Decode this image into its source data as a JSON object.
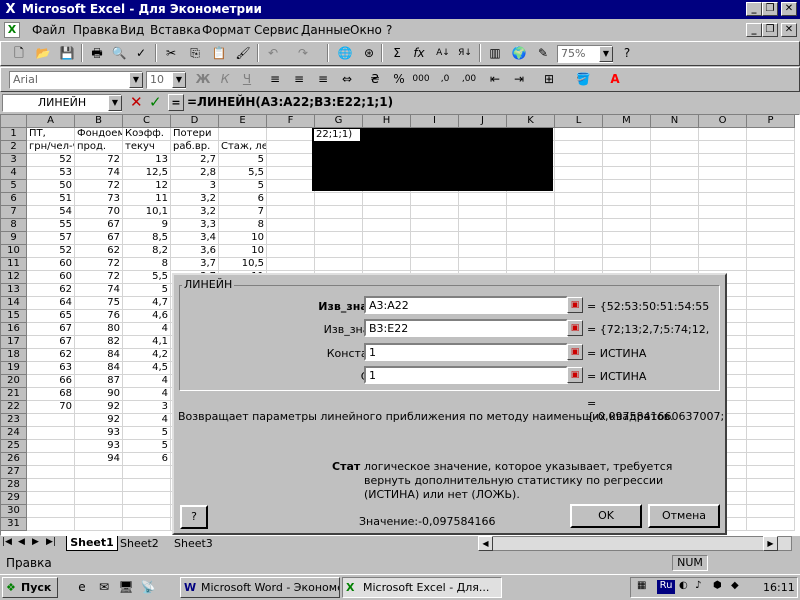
{
  "title": "Microsoft Excel - Для Эконометрии",
  "menu": [
    "Файл",
    "Правка",
    "Вид",
    "Вставка",
    "Формат",
    "Сервис",
    "Данные",
    "Окно",
    "?"
  ],
  "toolbar": {
    "zoom": "75%",
    "font": "Arial",
    "size": "10"
  },
  "namebox": "ЛИНЕЙН",
  "formula": "=ЛИНЕЙН(A3:A22;B3:E22;1;1)",
  "columns": [
    "A",
    "B",
    "C",
    "D",
    "E",
    "F",
    "G",
    "H",
    "I",
    "J",
    "K",
    "L",
    "M",
    "N",
    "O",
    "P"
  ],
  "rows": [
    [
      "ПТ,",
      "Фондоем",
      "Коэфф.",
      "Потери",
      ""
    ],
    [
      "грн/чел-ч",
      "прод.",
      "текуч",
      "раб.вр.",
      "Стаж, лет"
    ],
    [
      "52",
      "72",
      "13",
      "2,7",
      "5"
    ],
    [
      "53",
      "74",
      "12,5",
      "2,8",
      "5,5"
    ],
    [
      "50",
      "72",
      "12",
      "3",
      "5"
    ],
    [
      "51",
      "73",
      "11",
      "3,2",
      "6"
    ],
    [
      "54",
      "70",
      "10,1",
      "3,2",
      "7"
    ],
    [
      "55",
      "67",
      "9",
      "3,3",
      "8"
    ],
    [
      "57",
      "67",
      "8,5",
      "3,4",
      "10"
    ],
    [
      "52",
      "62",
      "8,2",
      "3,6",
      "10"
    ],
    [
      "60",
      "72",
      "8",
      "3,7",
      "10,5"
    ],
    [
      "60",
      "72",
      "5,5",
      "3,7",
      "11"
    ],
    [
      "62",
      "74",
      "5",
      "",
      ""
    ],
    [
      "64",
      "75",
      "4,7",
      "",
      ""
    ],
    [
      "65",
      "76",
      "4,6",
      "",
      ""
    ],
    [
      "67",
      "80",
      "4",
      "",
      ""
    ],
    [
      "67",
      "82",
      "4,1",
      "",
      ""
    ],
    [
      "62",
      "84",
      "4,2",
      "",
      ""
    ],
    [
      "63",
      "84",
      "4,5",
      "",
      ""
    ],
    [
      "66",
      "87",
      "4",
      "",
      ""
    ],
    [
      "68",
      "90",
      "4",
      "",
      ""
    ],
    [
      "70",
      "92",
      "3",
      "",
      ""
    ],
    [
      "",
      "92",
      "4",
      "",
      ""
    ],
    [
      "",
      "93",
      "5",
      "",
      ""
    ],
    [
      "",
      "93",
      "5",
      "",
      ""
    ],
    [
      "",
      "94",
      "6",
      "",
      ""
    ],
    [
      "",
      "",
      "",
      "",
      ""
    ],
    [
      "",
      "",
      "",
      "",
      ""
    ],
    [
      "",
      "",
      "",
      "",
      ""
    ],
    [
      "",
      "",
      "",
      "",
      ""
    ],
    [
      "",
      "",
      "",
      "",
      ""
    ]
  ],
  "g1_text": "22;1;1)",
  "dialog": {
    "group": "ЛИНЕЙН",
    "fields": [
      {
        "label": "Изв_знач_у",
        "value": "A3:A22",
        "result": "= {52:53:50:51:54:55"
      },
      {
        "label": "Изв_знач_х",
        "value": "B3:E22",
        "result": "= {72;13;2,7;5:74;12,"
      },
      {
        "label": "Константа",
        "value": "1",
        "result": "= ИСТИНА"
      },
      {
        "label": "Стат",
        "value": "1",
        "result": "= ИСТИНА"
      }
    ],
    "overall": "= {-0,0975841660637007;",
    "description": "Возвращает параметры линейного приближения по методу наименьших квадратов.",
    "arg_name": "Стат",
    "arg_desc": "логическое значение, которое указывает, требуется вернуть дополнительную статистику по регрессии (ИСТИНА) или нет (ЛОЖЬ).",
    "value_label": "Значение:-0,097584166",
    "ok": "OK",
    "cancel": "Отмена",
    "help": "?"
  },
  "sheets": [
    "Sheet1",
    "Sheet2",
    "Sheet3"
  ],
  "status": {
    "left": "Правка",
    "num": "NUM"
  },
  "taskbar": {
    "start": "Пуск",
    "tasks": [
      "Microsoft Word - Экономе...",
      "Microsoft Excel - Для..."
    ],
    "lang": "Ru",
    "time": "16:11"
  }
}
